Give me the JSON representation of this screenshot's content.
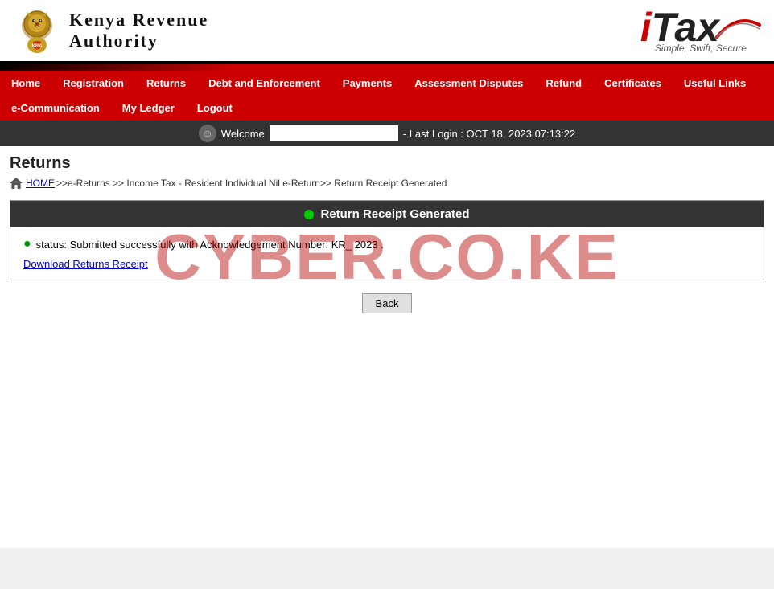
{
  "header": {
    "kra_name_line1": "Kenya Revenue",
    "kra_name_line2": "Authority",
    "itax_brand": "iTax",
    "itax_tagline": "Simple, Swift, Secure"
  },
  "nav": {
    "items_row1": [
      {
        "label": "Home",
        "id": "home"
      },
      {
        "label": "Registration",
        "id": "registration"
      },
      {
        "label": "Returns",
        "id": "returns"
      },
      {
        "label": "Debt and Enforcement",
        "id": "debt"
      },
      {
        "label": "Payments",
        "id": "payments"
      },
      {
        "label": "Assessment Disputes",
        "id": "assessment"
      },
      {
        "label": "Refund",
        "id": "refund"
      },
      {
        "label": "Certificates",
        "id": "certificates"
      },
      {
        "label": "Useful Links",
        "id": "useful-links"
      }
    ],
    "items_row2": [
      {
        "label": "e-Communication",
        "id": "ecomm"
      },
      {
        "label": "My Ledger",
        "id": "ledger"
      },
      {
        "label": "Logout",
        "id": "logout"
      }
    ]
  },
  "welcome_bar": {
    "welcome_label": "Welcome",
    "last_login_text": "- Last Login : OCT 18, 2023 07:13:22"
  },
  "page": {
    "title": "Returns",
    "breadcrumb_home": "HOME",
    "breadcrumb_rest": ">>e-Returns >> Income Tax - Resident Individual Nil e-Return>> Return Receipt Generated"
  },
  "receipt": {
    "header_title": "Return Receipt Generated",
    "success_text": "status: Submitted successfully with Acknowledgement Number: KR_ 2023  .",
    "download_link": "Download Returns Receipt"
  },
  "buttons": {
    "back": "Back"
  },
  "watermark": {
    "text": "CYBER.CO.KE"
  }
}
